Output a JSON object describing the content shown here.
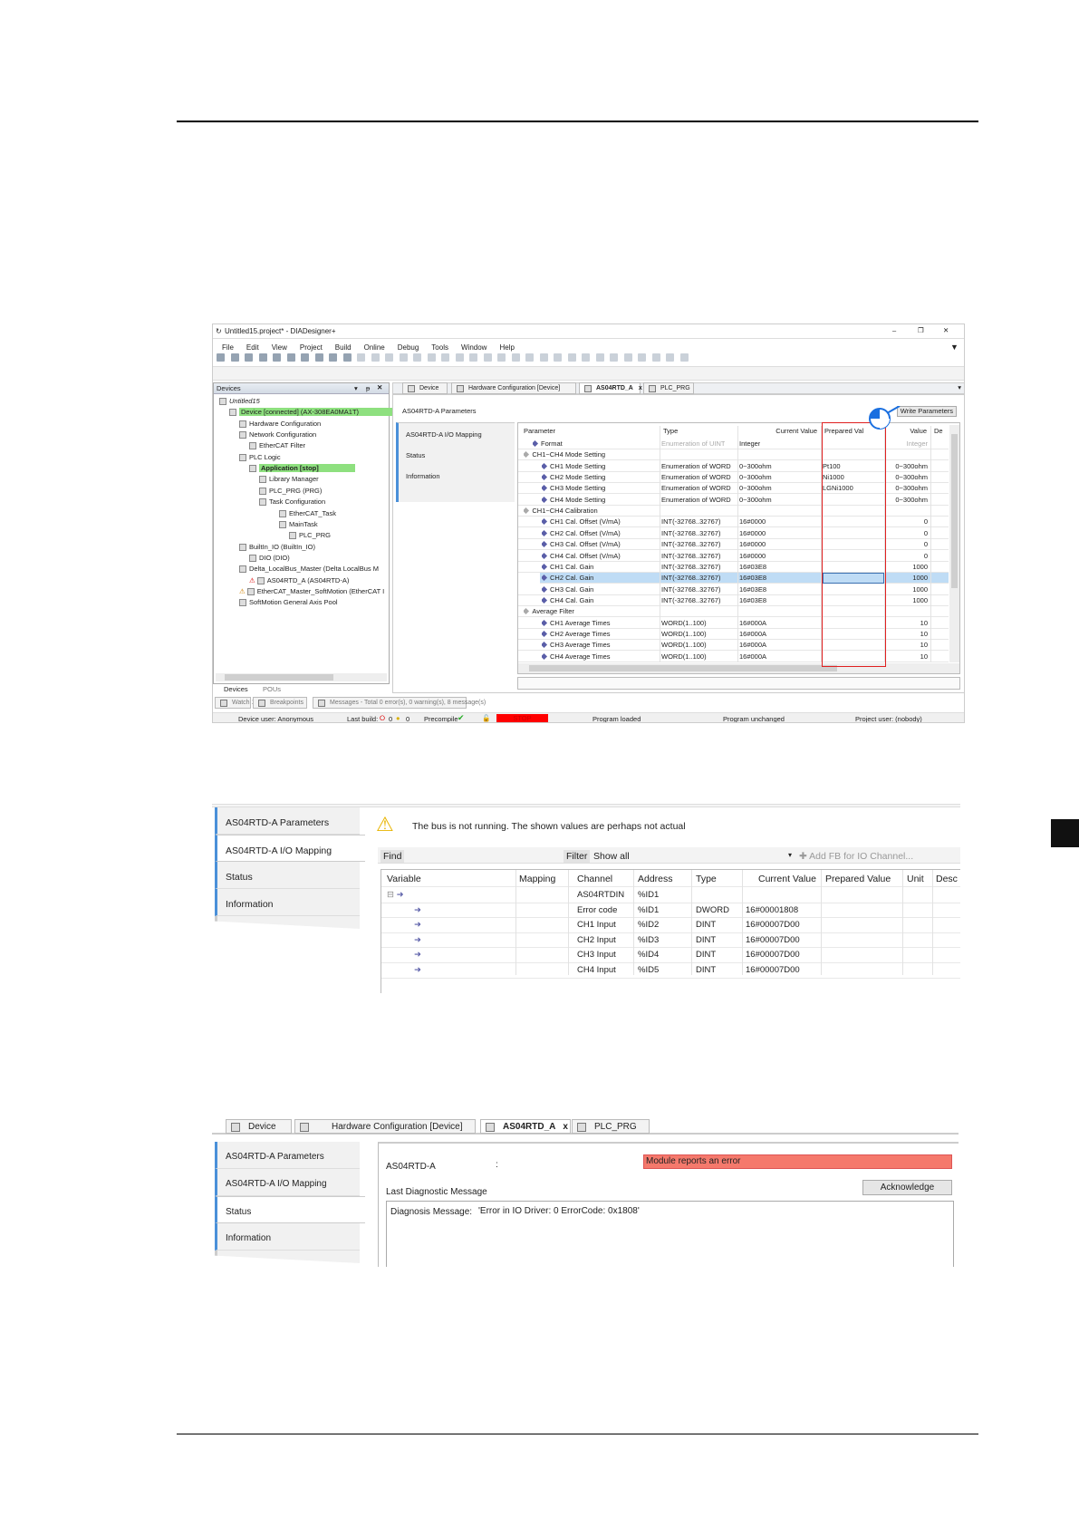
{
  "screenshot1": {
    "title": "Untitled15.project* - DIADesigner+",
    "window_controls": [
      "–",
      "❐",
      "✕"
    ],
    "menu": [
      "File",
      "Edit",
      "View",
      "Project",
      "Build",
      "Online",
      "Debug",
      "Tools",
      "Window",
      "Help"
    ],
    "toolbar_icons": [
      "new-icon",
      "open-icon",
      "save-icon",
      "print-icon",
      "undo-icon",
      "redo-icon",
      "cut-icon",
      "copy-icon",
      "paste-icon",
      "delete-icon",
      "find-icon",
      "replace-icon",
      "find-in-project-icon",
      "replace-in-project-icon",
      "bookmark-icon",
      "bookmark-prev-icon",
      "bookmark-next-icon",
      "bookmark-clear-icon",
      "build-icon",
      "add-object-icon",
      "add-folder-icon",
      "login-icon",
      "logout-icon",
      "run-icon",
      "stop-icon",
      "reset-icon",
      "breakpoint-icon",
      "step-over-icon",
      "step-into-icon",
      "step-out-icon",
      "run-to-cursor-icon",
      "write-values-icon",
      "monitor-icon",
      "settings-icon"
    ],
    "devices_panel": {
      "title": "Devices",
      "tree": [
        {
          "label": "Untitled15",
          "level": 0,
          "italic": true
        },
        {
          "label": "Device [connected] (AX-308EA0MA1T)",
          "level": 1,
          "highlight": true
        },
        {
          "label": "Hardware Configuration",
          "level": 2
        },
        {
          "label": "Network Configuration",
          "level": 2
        },
        {
          "label": "EtherCAT Filter",
          "level": 3
        },
        {
          "label": "PLC Logic",
          "level": 2
        },
        {
          "label": "Application [stop]",
          "level": 3,
          "highlight": true,
          "bold": true
        },
        {
          "label": "Library Manager",
          "level": 4
        },
        {
          "label": "PLC_PRG (PRG)",
          "level": 4
        },
        {
          "label": "Task Configuration",
          "level": 4
        },
        {
          "label": "EtherCAT_Task",
          "level": 6
        },
        {
          "label": "MainTask",
          "level": 6
        },
        {
          "label": "PLC_PRG",
          "level": 7
        },
        {
          "label": "BuiltIn_IO (BuiltIn_IO)",
          "level": 2
        },
        {
          "label": "DIO (DIO)",
          "level": 3
        },
        {
          "label": "Delta_LocalBus_Master (Delta LocalBus M",
          "level": 2
        },
        {
          "label": "AS04RTD_A (AS04RTD-A)",
          "level": 3,
          "error": true
        },
        {
          "label": "EtherCAT_Master_SoftMotion (EtherCAT I",
          "level": 2,
          "warning": true
        },
        {
          "label": "SoftMotion General Axis Pool",
          "level": 2
        }
      ],
      "bottom_tabs": [
        "Devices",
        "POUs"
      ]
    },
    "editor_tabs": [
      {
        "label": "Device"
      },
      {
        "label": "Hardware Configuration [Device]"
      },
      {
        "label": "AS04RTD_A",
        "active": true,
        "close": "x"
      },
      {
        "label": "PLC_PRG"
      }
    ],
    "header": "AS04RTD-A Parameters",
    "write_parameters": "Write Parameters",
    "nav": [
      "AS04RTD-A I/O Mapping",
      "Status",
      "Information"
    ],
    "grid": {
      "columns": [
        "Parameter",
        "Type",
        "Current Value",
        "Prepared Val",
        "Value",
        "De"
      ],
      "rows": [
        {
          "name": "Format",
          "level": 1,
          "type": "Enumeration of UINT",
          "current": "Integer",
          "prepared": "",
          "value": "Integer",
          "dim": true
        },
        {
          "name": "CH1~CH4 Mode Setting",
          "level": 0,
          "group": true
        },
        {
          "name": "CH1 Mode Setting",
          "level": 2,
          "type": "Enumeration of WORD",
          "current": "0~300ohm",
          "prepared": "Pt100",
          "value": "0~300ohm"
        },
        {
          "name": "CH2 Mode Setting",
          "level": 2,
          "type": "Enumeration of WORD",
          "current": "0~300ohm",
          "prepared": "Ni1000",
          "value": "0~300ohm"
        },
        {
          "name": "CH3 Mode Setting",
          "level": 2,
          "type": "Enumeration of WORD",
          "current": "0~300ohm",
          "prepared": "LGNi1000",
          "value": "0~300ohm"
        },
        {
          "name": "CH4 Mode Setting",
          "level": 2,
          "type": "Enumeration of WORD",
          "current": "0~300ohm",
          "prepared": "",
          "value": "0~300ohm"
        },
        {
          "name": "CH1~CH4 Calibration",
          "level": 0,
          "group": true
        },
        {
          "name": "CH1 Cal. Offset (V/mA)",
          "level": 2,
          "type": "INT(-32768..32767)",
          "current": "16#0000",
          "prepared": "",
          "value": "0"
        },
        {
          "name": "CH2 Cal. Offset (V/mA)",
          "level": 2,
          "type": "INT(-32768..32767)",
          "current": "16#0000",
          "prepared": "",
          "value": "0"
        },
        {
          "name": "CH3 Cal. Offset (V/mA)",
          "level": 2,
          "type": "INT(-32768..32767)",
          "current": "16#0000",
          "prepared": "",
          "value": "0"
        },
        {
          "name": "CH4 Cal. Offset (V/mA)",
          "level": 2,
          "type": "INT(-32768..32767)",
          "current": "16#0000",
          "prepared": "",
          "value": "0"
        },
        {
          "name": "CH1 Cal. Gain",
          "level": 2,
          "type": "INT(-32768..32767)",
          "current": "16#03E8",
          "prepared": "",
          "value": "1000"
        },
        {
          "name": "CH2 Cal. Gain",
          "level": 2,
          "type": "INT(-32768..32767)",
          "current": "16#03E8",
          "prepared": "",
          "value": "1000",
          "selected": true
        },
        {
          "name": "CH3 Cal. Gain",
          "level": 2,
          "type": "INT(-32768..32767)",
          "current": "16#03E8",
          "prepared": "",
          "value": "1000"
        },
        {
          "name": "CH4 Cal. Gain",
          "level": 2,
          "type": "INT(-32768..32767)",
          "current": "16#03E8",
          "prepared": "",
          "value": "1000"
        },
        {
          "name": "Average Filter",
          "level": 0,
          "group": true
        },
        {
          "name": "CH1 Average Times",
          "level": 2,
          "type": "WORD(1..100)",
          "current": "16#000A",
          "prepared": "",
          "value": "10"
        },
        {
          "name": "CH2 Average Times",
          "level": 2,
          "type": "WORD(1..100)",
          "current": "16#000A",
          "prepared": "",
          "value": "10"
        },
        {
          "name": "CH3 Average Times",
          "level": 2,
          "type": "WORD(1..100)",
          "current": "16#000A",
          "prepared": "",
          "value": "10"
        },
        {
          "name": "CH4 Average Times",
          "level": 2,
          "type": "WORD(1..100)",
          "current": "16#000A",
          "prepared": "",
          "value": "10"
        }
      ]
    },
    "message_tabs": [
      "Watch 1",
      "Breakpoints",
      "Messages - Total 0 error(s), 0 warning(s), 8 message(s)"
    ],
    "status_bar": {
      "device_user": "Device user: Anonymous",
      "last_build": "Last build:",
      "errors": "0",
      "warnings": "0",
      "precompile": "Precompile",
      "stop": "STOP",
      "program_loaded": "Program loaded",
      "program_unchanged": "Program unchanged",
      "project_user": "Project user: (nobody)"
    },
    "colors": {
      "highlight": "#8ee07f",
      "annotation": "#e02020",
      "selection": "#bfdcf5",
      "stop": "#ff0000"
    }
  },
  "screenshot2": {
    "nav": [
      "AS04RTD-A Parameters",
      "AS04RTD-A I/O Mapping",
      "Status",
      "Information"
    ],
    "active_nav": 1,
    "warning": "The bus is not running. The shown values are perhaps not actual",
    "find": "Find",
    "filter": "Filter",
    "filter_value": "Show all",
    "add_fb": "Add FB for IO Channel...",
    "columns": [
      "Variable",
      "Mapping",
      "Channel",
      "Address",
      "Type",
      "Current Value",
      "Prepared Value",
      "Unit",
      "Desc"
    ],
    "rows": [
      {
        "channel": "AS04RTDIN",
        "address": "%ID1",
        "type": "",
        "current": "",
        "root": true
      },
      {
        "channel": "Error code",
        "address": "%ID1",
        "type": "DWORD",
        "current": "16#00001808"
      },
      {
        "channel": "CH1 Input",
        "address": "%ID2",
        "type": "DINT",
        "current": "16#00007D00"
      },
      {
        "channel": "CH2 Input",
        "address": "%ID3",
        "type": "DINT",
        "current": "16#00007D00"
      },
      {
        "channel": "CH3 Input",
        "address": "%ID4",
        "type": "DINT",
        "current": "16#00007D00"
      },
      {
        "channel": "CH4 Input",
        "address": "%ID5",
        "type": "DINT",
        "current": "16#00007D00"
      }
    ]
  },
  "screenshot3": {
    "tabs": [
      "Device",
      "Hardware Configuration [Device]",
      "AS04RTD_A",
      "PLC_PRG"
    ],
    "close": "x",
    "nav": [
      "AS04RTD-A Parameters",
      "AS04RTD-A I/O Mapping",
      "Status",
      "Information"
    ],
    "active_nav": 2,
    "module_label": "AS04RTD-A",
    "colon": ":",
    "module_status": "Module reports an error",
    "last_diag": "Last Diagnostic Message",
    "acknowledge": "Acknowledge",
    "diag_label": "Diagnosis Message:",
    "diag_message": "'Error in IO Driver: 0 ErrorCode: 0x1808'"
  }
}
